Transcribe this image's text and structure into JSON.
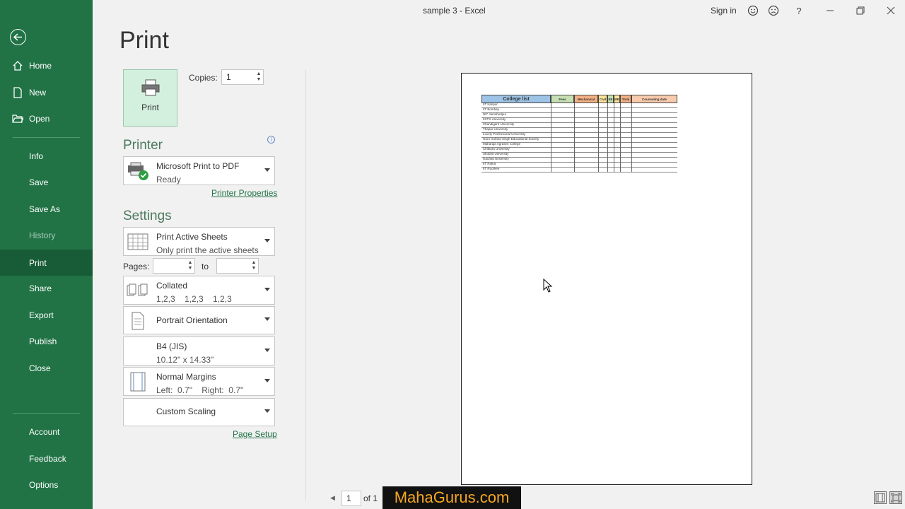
{
  "window": {
    "title": "sample 3  -  Excel",
    "sign_in": "Sign in",
    "icons": [
      "smile-icon",
      "frown-icon",
      "help-icon",
      "minimize-icon",
      "restore-icon",
      "close-icon"
    ]
  },
  "nav": {
    "back_icon": "back-arrow-icon",
    "items": [
      {
        "label": "Home",
        "icon": "home-icon"
      },
      {
        "label": "New",
        "icon": "new-doc-icon"
      },
      {
        "label": "Open",
        "icon": "folder-icon"
      },
      {
        "label": "Info"
      },
      {
        "label": "Save"
      },
      {
        "label": "Save As"
      },
      {
        "label": "History"
      },
      {
        "label": "Print"
      },
      {
        "label": "Share"
      },
      {
        "label": "Export"
      },
      {
        "label": "Publish"
      },
      {
        "label": "Close"
      },
      {
        "label": "Account"
      },
      {
        "label": "Feedback"
      },
      {
        "label": "Options"
      }
    ]
  },
  "print": {
    "heading": "Print",
    "button_label": "Print",
    "copies_label": "Copies:",
    "copies_value": "1"
  },
  "printer": {
    "section": "Printer",
    "name": "Microsoft Print to PDF",
    "status": "Ready",
    "properties_link": "Printer Properties"
  },
  "settings": {
    "section": "Settings",
    "scope": {
      "main": "Print Active Sheets",
      "sub": "Only print the active sheets"
    },
    "pages_label": "Pages:",
    "to_label": "to",
    "collation": {
      "main": "Collated",
      "sub": "1,2,3    1,2,3    1,2,3"
    },
    "orientation": {
      "main": "Portrait Orientation"
    },
    "paper": {
      "main": "B4 (JIS)",
      "sub": "10.12\" x 14.33\""
    },
    "margins": {
      "main": "Normal Margins",
      "sub": "Left:  0.7\"    Right:  0.7\""
    },
    "scaling": {
      "main": "Custom Scaling"
    },
    "page_setup_link": "Page Setup"
  },
  "preview": {
    "table_title": "College list",
    "headers": [
      "College list",
      "Fees",
      "Mechanical",
      "Civil",
      "EE",
      "ME",
      "Total",
      "Counseling date"
    ],
    "header_colors": [
      "#9dc3e6",
      "#c6e0b4",
      "#f4b183",
      "#ffe699",
      "#c6e0b4",
      "#ffe699",
      "#f4b183",
      "#f8cbad"
    ],
    "rows": [
      "IIT Kanpur",
      "IIT Bombay",
      "NIT Jamshedpur",
      "KIITS University",
      "Chandigarh University",
      "Thapar University",
      "Lovely Professional University",
      "Guru Gobind Singh Educational Society",
      "Maharaja Agrasen College",
      "Chitkara University",
      "Shobhit University",
      "Gauhati University",
      "IIT Patna",
      "IIT Roorkee"
    ]
  },
  "footer": {
    "page_current": "1",
    "page_of": "of 1",
    "watermark": "MahaGurus.com",
    "icons": [
      "show-margins-icon",
      "zoom-to-page-icon"
    ]
  }
}
